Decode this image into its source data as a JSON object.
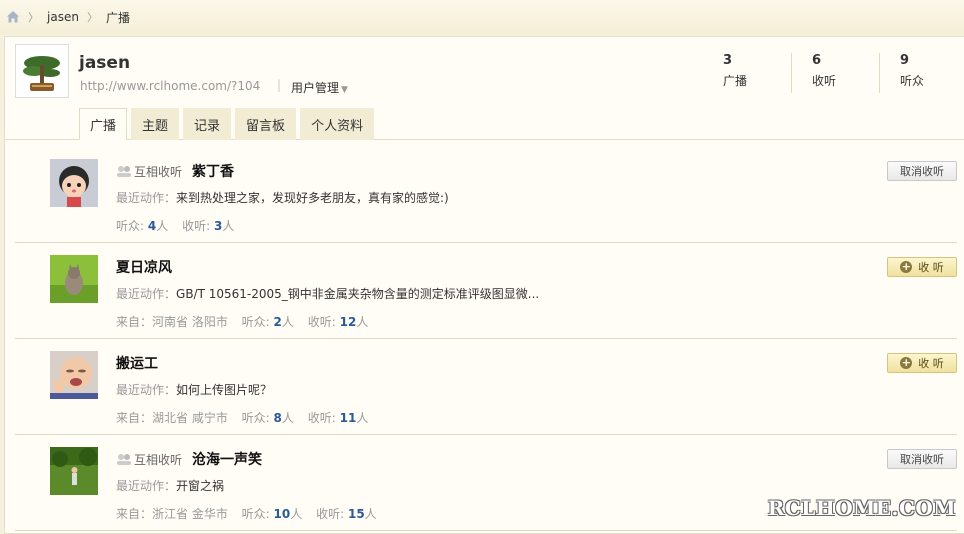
{
  "breadcrumb": {
    "items": [
      "jasen",
      "广播"
    ]
  },
  "profile": {
    "name": "jasen",
    "url": "http://www.rclhome.com/?104",
    "manage_label": "用户管理",
    "stats": [
      {
        "num": "3",
        "label": "广播"
      },
      {
        "num": "6",
        "label": "收听"
      },
      {
        "num": "9",
        "label": "听众"
      }
    ],
    "tabs": [
      "广播",
      "主题",
      "记录",
      "留言板",
      "个人资料"
    ],
    "active_tab": "广播"
  },
  "list": [
    {
      "mutual": "互相收听",
      "name": "紫丁香",
      "recent_key": "最近动作：",
      "recent": "来到热处理之家，发现好多老朋友，真有家的感觉:)",
      "from_key": "",
      "from": "",
      "listeners_key": "听众:",
      "listeners": "4",
      "following_key": "收听:",
      "following": "3",
      "unit": "人",
      "button": "取消收听",
      "button_type": "unfollow"
    },
    {
      "mutual": "",
      "name": "夏日凉风",
      "recent_key": "最近动作：",
      "recent": "GB/T 10561-2005_钢中非金属夹杂物含量的测定标准评级图显微...",
      "from_key": "来自：",
      "from": "河南省 洛阳市",
      "listeners_key": "听众:",
      "listeners": "2",
      "following_key": "收听:",
      "following": "12",
      "unit": "人",
      "button": "收 听",
      "button_type": "follow"
    },
    {
      "mutual": "",
      "name": "搬运工",
      "recent_key": "最近动作：",
      "recent": "如何上传图片呢？",
      "from_key": "来自：",
      "from": "湖北省 咸宁市",
      "listeners_key": "听众:",
      "listeners": "8",
      "following_key": "收听:",
      "following": "11",
      "unit": "人",
      "button": "收 听",
      "button_type": "follow"
    },
    {
      "mutual": "互相收听",
      "name": "沧海一声笑",
      "recent_key": "最近动作：",
      "recent": "开窗之祸",
      "from_key": "来自：",
      "from": "浙江省 金华市",
      "listeners_key": "听众:",
      "listeners": "10",
      "following_key": "收听:",
      "following": "15",
      "unit": "人",
      "button": "取消收听",
      "button_type": "unfollow"
    }
  ],
  "watermark": "RCLHOME.COM",
  "colors": {
    "background": "#f6f1de",
    "panel": "#fffdf6",
    "link_number": "#2a5a9a",
    "follow_button": "#efe1a0"
  }
}
